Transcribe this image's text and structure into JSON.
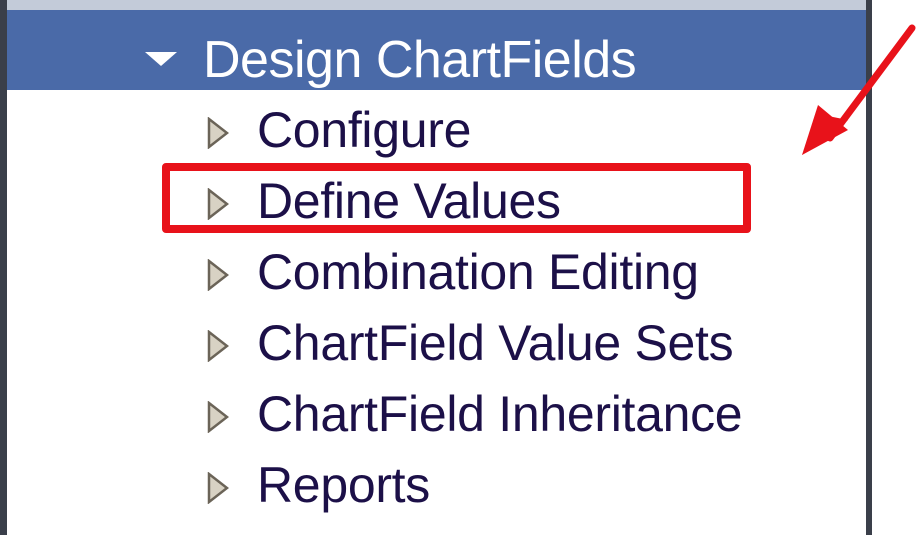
{
  "menu": {
    "section_title": "Design ChartFields",
    "items": [
      {
        "label": "Configure",
        "icon": "expand-triangle-icon"
      },
      {
        "label": "Define Values",
        "icon": "expand-triangle-icon",
        "highlighted": true
      },
      {
        "label": "Combination Editing",
        "icon": "expand-triangle-icon"
      },
      {
        "label": "ChartField Value Sets",
        "icon": "expand-triangle-icon"
      },
      {
        "label": "ChartField Inheritance",
        "icon": "expand-triangle-icon"
      },
      {
        "label": "Reports",
        "icon": "expand-triangle-icon"
      }
    ]
  },
  "colors": {
    "header_background": "#4a6aa8",
    "header_text": "#ffffff",
    "item_text": "#1c1048",
    "annotation_red": "#e8121a"
  }
}
